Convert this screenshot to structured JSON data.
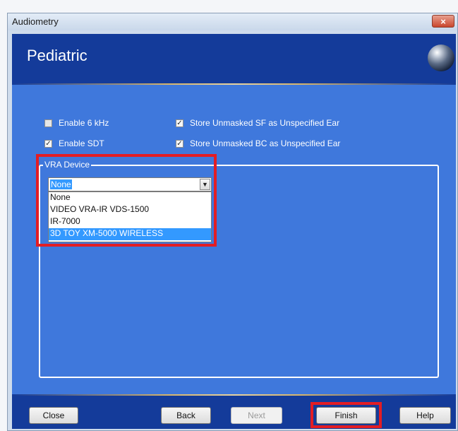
{
  "window": {
    "title": "Audiometry",
    "close_glyph": "×"
  },
  "header": {
    "title": "Pediatric"
  },
  "options": {
    "enable_6khz": {
      "label": "Enable 6 kHz",
      "checked": false
    },
    "enable_sdt": {
      "label": "Enable SDT",
      "checked": true
    },
    "store_sf": {
      "label": "Store Unmasked SF as Unspecified Ear",
      "checked": true
    },
    "store_bc": {
      "label": "Store Unmasked BC as Unspecified Ear",
      "checked": true
    }
  },
  "vra": {
    "group_label": "VRA Device",
    "selected": "None",
    "options": [
      "None",
      "VIDEO VRA-IR VDS-1500",
      "IR-7000",
      "3D TOY XM-5000 WIRELESS"
    ],
    "highlighted_option": "3D TOY XM-5000 WIRELESS"
  },
  "buttons": {
    "close": "Close",
    "back": "Back",
    "next": "Next",
    "finish": "Finish",
    "help": "Help"
  },
  "icons": {
    "check": "✓",
    "dropdown": "▼"
  },
  "colors": {
    "header_bg": "#143b9a",
    "content_bg": "#3f78dc",
    "highlight": "#e31d24",
    "selection": "#3399ff"
  }
}
